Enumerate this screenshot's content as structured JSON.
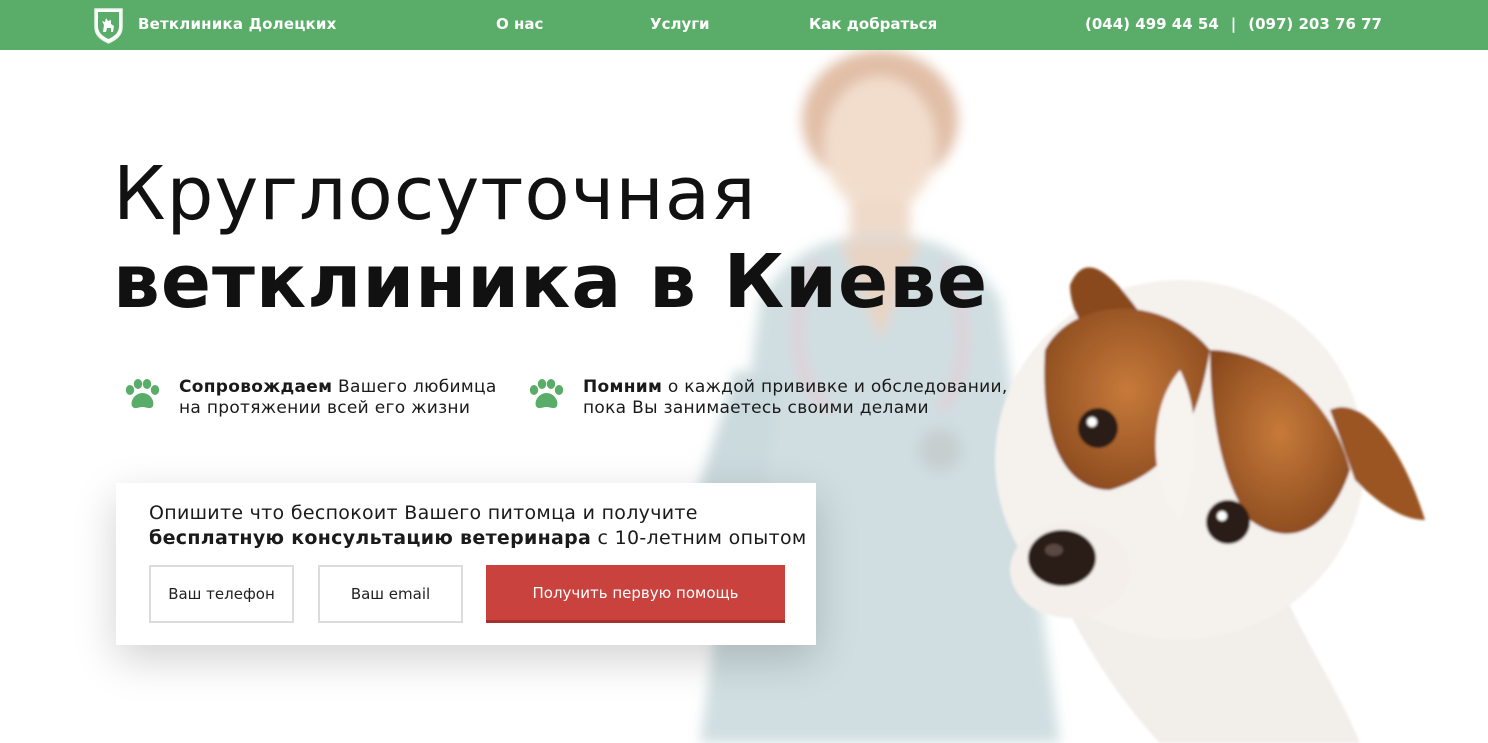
{
  "header": {
    "brand": "Ветклиника Долецких",
    "nav": [
      {
        "label": "О нас"
      },
      {
        "label": "Услуги"
      },
      {
        "label": "Как добраться"
      }
    ],
    "phone_1": "(044) 499 44 54",
    "phone_separator": "|",
    "phone_2": "(097) 203 76 77"
  },
  "hero": {
    "title_line1": "Круглосуточная",
    "title_line2_bold": "ветклиника",
    "title_line2_rest": " в Киеве"
  },
  "features": [
    {
      "bold": "Сопровождаем",
      "rest": " Вашего любимца",
      "line2": "на протяжении всей его жизни"
    },
    {
      "bold": "Помним",
      "rest": " о каждой прививке и обследовании,",
      "line2": "пока Вы занимаетесь своими делами"
    }
  ],
  "form": {
    "lead_line1": "Опишите что беспокоит Вашего питомца и получите",
    "lead_bold": "бесплатную консультацию ветеринара",
    "lead_rest": " с 10-летним опытом",
    "phone_placeholder": "Ваш телефон",
    "email_placeholder": "Ваш email",
    "submit_label": "Получить первую помощь"
  },
  "colors": {
    "header_bg": "#5aad69",
    "accent_green": "#5aad69",
    "cta_red": "#c9423d"
  },
  "icons": [
    "shield-deer-logo-icon",
    "paw-icon"
  ]
}
